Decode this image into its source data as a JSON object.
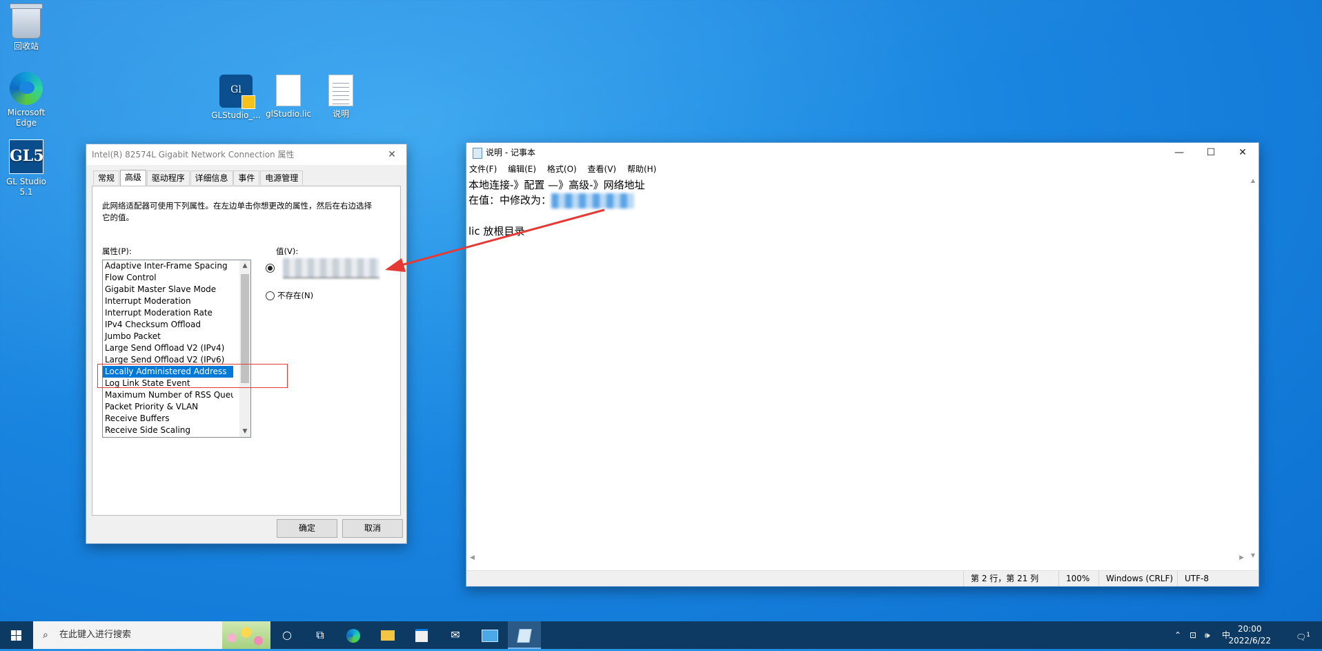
{
  "desktop": {
    "icons": [
      {
        "label": "回收站"
      },
      {
        "label": "Microsoft\nEdge"
      },
      {
        "label": "GL Studio\n5.1"
      },
      {
        "label": "GLStudio_..."
      },
      {
        "label": "glStudio.lic"
      },
      {
        "label": "说明"
      }
    ],
    "glstudio_glyph": "Gl",
    "gl5_glyph": "GL5"
  },
  "props_dialog": {
    "title": "Intel(R) 82574L Gigabit Network Connection 属性",
    "tabs": [
      "常规",
      "高级",
      "驱动程序",
      "详细信息",
      "事件",
      "电源管理"
    ],
    "active_tab": "高级",
    "description": "此网络适配器可使用下列属性。在左边单击你想更改的属性，然后在右边选择它的值。",
    "property_label": "属性(P):",
    "value_label": "值(V):",
    "not_present_label": "不存在(N)",
    "properties": [
      "Adaptive Inter-Frame Spacing",
      "Flow Control",
      "Gigabit Master Slave Mode",
      "Interrupt Moderation",
      "Interrupt Moderation Rate",
      "IPv4 Checksum Offload",
      "Jumbo Packet",
      "Large Send Offload V2 (IPv4)",
      "Large Send Offload V2 (IPv6)",
      "Locally Administered Address",
      "Log Link State Event",
      "Maximum Number of RSS Queue",
      "Packet Priority & VLAN",
      "Receive Buffers",
      "Receive Side Scaling"
    ],
    "selected_property": "Locally Administered Address",
    "ok_label": "确定",
    "cancel_label": "取消"
  },
  "notepad": {
    "title": "说明 - 记事本",
    "menus": [
      "文件(F)",
      "编辑(E)",
      "格式(O)",
      "查看(V)",
      "帮助(H)"
    ],
    "lines": [
      "本地连接-》配置 —》高级-》网络地址",
      "在值：中修改为：",
      "",
      "lic 放根目录"
    ],
    "status": {
      "position": "第 2 行，第 21 列",
      "zoom": "100%",
      "eol": "Windows (CRLF)",
      "encoding": "UTF-8"
    }
  },
  "taskbar": {
    "search_placeholder": "在此键入进行搜索",
    "time": "20:00",
    "date": "2022/6/22",
    "ime": "中",
    "notification_count": "1"
  },
  "colors": {
    "selection": "#0078d7",
    "annotation": "#e53935",
    "taskbar": "#0c3a63"
  }
}
